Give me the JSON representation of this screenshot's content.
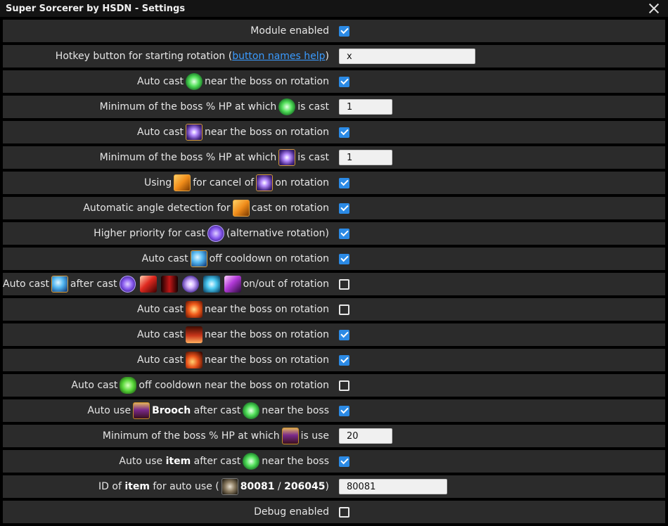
{
  "window": {
    "title": "Super Sorcerer by HSDN - Settings"
  },
  "rows": {
    "r0": {
      "label": "Module enabled",
      "checked": true
    },
    "r1": {
      "pre": "Hotkey button for starting rotation (",
      "link": "button names help",
      "post": ")",
      "value": "x"
    },
    "r2": {
      "pre": "Auto cast",
      "post": "near the boss on rotation",
      "icon": "green-burst-skill-icon",
      "checked": true
    },
    "r3": {
      "pre": "Minimum of the boss % HP at which",
      "post": "is cast",
      "icon": "green-burst-skill-icon",
      "value": "1"
    },
    "r4": {
      "pre": "Auto cast",
      "post": "near the boss on rotation",
      "icon": "purple-sparkle-skill-icon",
      "checked": true
    },
    "r5": {
      "pre": "Minimum of the boss % HP at which",
      "post": "is cast",
      "icon": "purple-sparkle-skill-icon",
      "value": "1"
    },
    "r6": {
      "pre": "Using",
      "mid": "for cancel of",
      "post": "on rotation",
      "icon1": "orange-staff-skill-icon",
      "icon2": "purple-sparkle-skill-icon",
      "checked": true
    },
    "r7": {
      "pre": "Automatic angle detection for",
      "post": "cast on rotation",
      "icon": "orange-staff-skill-icon",
      "checked": true
    },
    "r8": {
      "pre": "Higher priority for cast",
      "post": "(alternative rotation)",
      "icon": "purple-orb-skill-icon",
      "checked": true
    },
    "r9": {
      "pre": "Auto cast",
      "post": "off cooldown on rotation",
      "icon": "blue-swirl-skill-icon",
      "checked": true
    },
    "r10": {
      "pre": "Auto cast",
      "mid": "after cast",
      "post": "on/out of rotation",
      "checked": false
    },
    "r11": {
      "pre": "Auto cast",
      "post": "near the boss on rotation",
      "icon": "fire-skill-icon",
      "checked": false
    },
    "r12": {
      "pre": "Auto cast",
      "post": "near the boss on rotation",
      "icon": "flame-pillar-skill-icon",
      "checked": true
    },
    "r13": {
      "pre": "Auto cast",
      "post": "near the boss on rotation",
      "icon": "fireball-skill-icon",
      "checked": true
    },
    "r14": {
      "pre": "Auto cast",
      "post": "off cooldown near the boss on rotation",
      "icon": "green-gem-skill-icon",
      "checked": false
    },
    "r15": {
      "pre": "Auto use",
      "bold": "Brooch",
      "mid": "after cast",
      "post": "near the boss",
      "checked": true
    },
    "r16": {
      "pre": "Minimum of the boss % HP at which",
      "post": "is use",
      "icon": "brooch-icon",
      "value": "20"
    },
    "r17": {
      "pre": "Auto use",
      "bold": "item",
      "mid": "after cast",
      "post": "near the boss",
      "checked": true
    },
    "r18": {
      "pre": "ID of",
      "bold": "item",
      "mid": "for auto use (",
      "bold2": "80081",
      "sep": "/",
      "bold3": "206045",
      "post": ")",
      "value": "80081"
    },
    "r19": {
      "label": "Debug enabled",
      "checked": false
    }
  }
}
